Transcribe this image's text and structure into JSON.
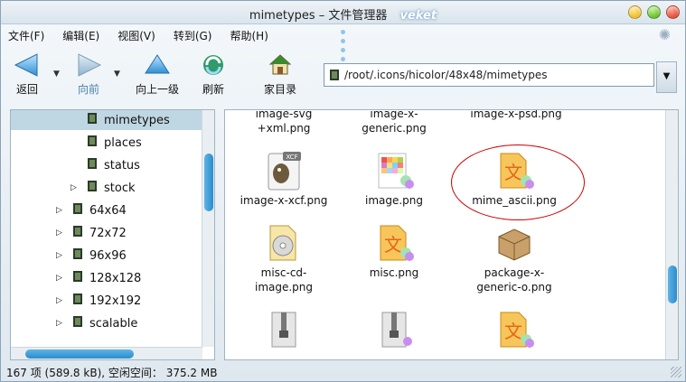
{
  "window": {
    "title": "mimetypes – 文件管理器",
    "brand": "veket"
  },
  "menu": [
    "文件(F)",
    "编辑(E)",
    "视图(V)",
    "转到(G)",
    "帮助(H)"
  ],
  "toolbar": {
    "back_label": "返回",
    "forward_label": "向前",
    "up_label": "向上一级",
    "refresh_label": "刷新",
    "home_label": "家目录"
  },
  "location": {
    "path": "/root/.icons/hicolor/48x48/mimetypes"
  },
  "sidebar": {
    "items": [
      {
        "label": "mimetypes",
        "selected": true,
        "expandable": false
      },
      {
        "label": "places",
        "selected": false,
        "expandable": false
      },
      {
        "label": "status",
        "selected": false,
        "expandable": false
      },
      {
        "label": "stock",
        "selected": false,
        "expandable": true
      },
      {
        "label": "64x64",
        "selected": false,
        "expandable": true
      },
      {
        "label": "72x72",
        "selected": false,
        "expandable": true
      },
      {
        "label": "96x96",
        "selected": false,
        "expandable": true
      },
      {
        "label": "128x128",
        "selected": false,
        "expandable": true
      },
      {
        "label": "192x192",
        "selected": false,
        "expandable": true
      },
      {
        "label": "scalable",
        "selected": false,
        "expandable": true
      }
    ]
  },
  "files": [
    {
      "name": "image-svg\n+xml.png",
      "icon": "svg-image-icon"
    },
    {
      "name": "image-x-\ngeneric.png",
      "icon": "generic-image-icon"
    },
    {
      "name": "image-x-psd.png",
      "icon": "psd-image-icon"
    },
    {
      "name": "image-x-xcf.png",
      "icon": "gimp-xcf-icon"
    },
    {
      "name": "image.png",
      "icon": "image-file-icon"
    },
    {
      "name": "mime_ascii.png",
      "icon": "text-document-icon"
    },
    {
      "name": "misc-cd-\nimage.png",
      "icon": "cd-image-icon"
    },
    {
      "name": "misc.png",
      "icon": "text-document-icon"
    },
    {
      "name": "package-x-\ngeneric-o.png",
      "icon": "package-box-icon"
    },
    {
      "name": "",
      "icon": "archive-zip-icon"
    },
    {
      "name": "",
      "icon": "archive-zip-icon"
    },
    {
      "name": "",
      "icon": "text-document-icon"
    }
  ],
  "status": {
    "text": "167 项 (589.8 kB), 空闲空间： 375.2 MB"
  },
  "colors": {
    "selection": "#bfd6e3",
    "scroll_thumb": "#2a8ccb",
    "annotation_ring": "#cc0000"
  }
}
